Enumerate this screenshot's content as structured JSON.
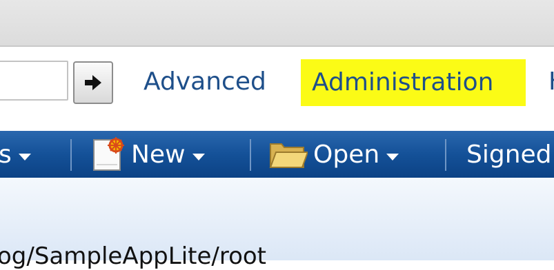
{
  "search": {
    "value": ""
  },
  "nav": {
    "go_icon": "arrow-right-icon",
    "advanced": "Advanced",
    "administration": "Administration",
    "cut_link": "H"
  },
  "toolbar": {
    "cut_item": "s",
    "new_label": "New",
    "new_icon": "new-document-icon",
    "open_label": "Open",
    "open_icon": "folder-icon",
    "signed_label": "Signed"
  },
  "content": {
    "path": "og/SampleAppLite/root"
  },
  "colors": {
    "toolbar": "#145198",
    "highlight": "#fbfb16",
    "link": "#1e4f8a"
  }
}
